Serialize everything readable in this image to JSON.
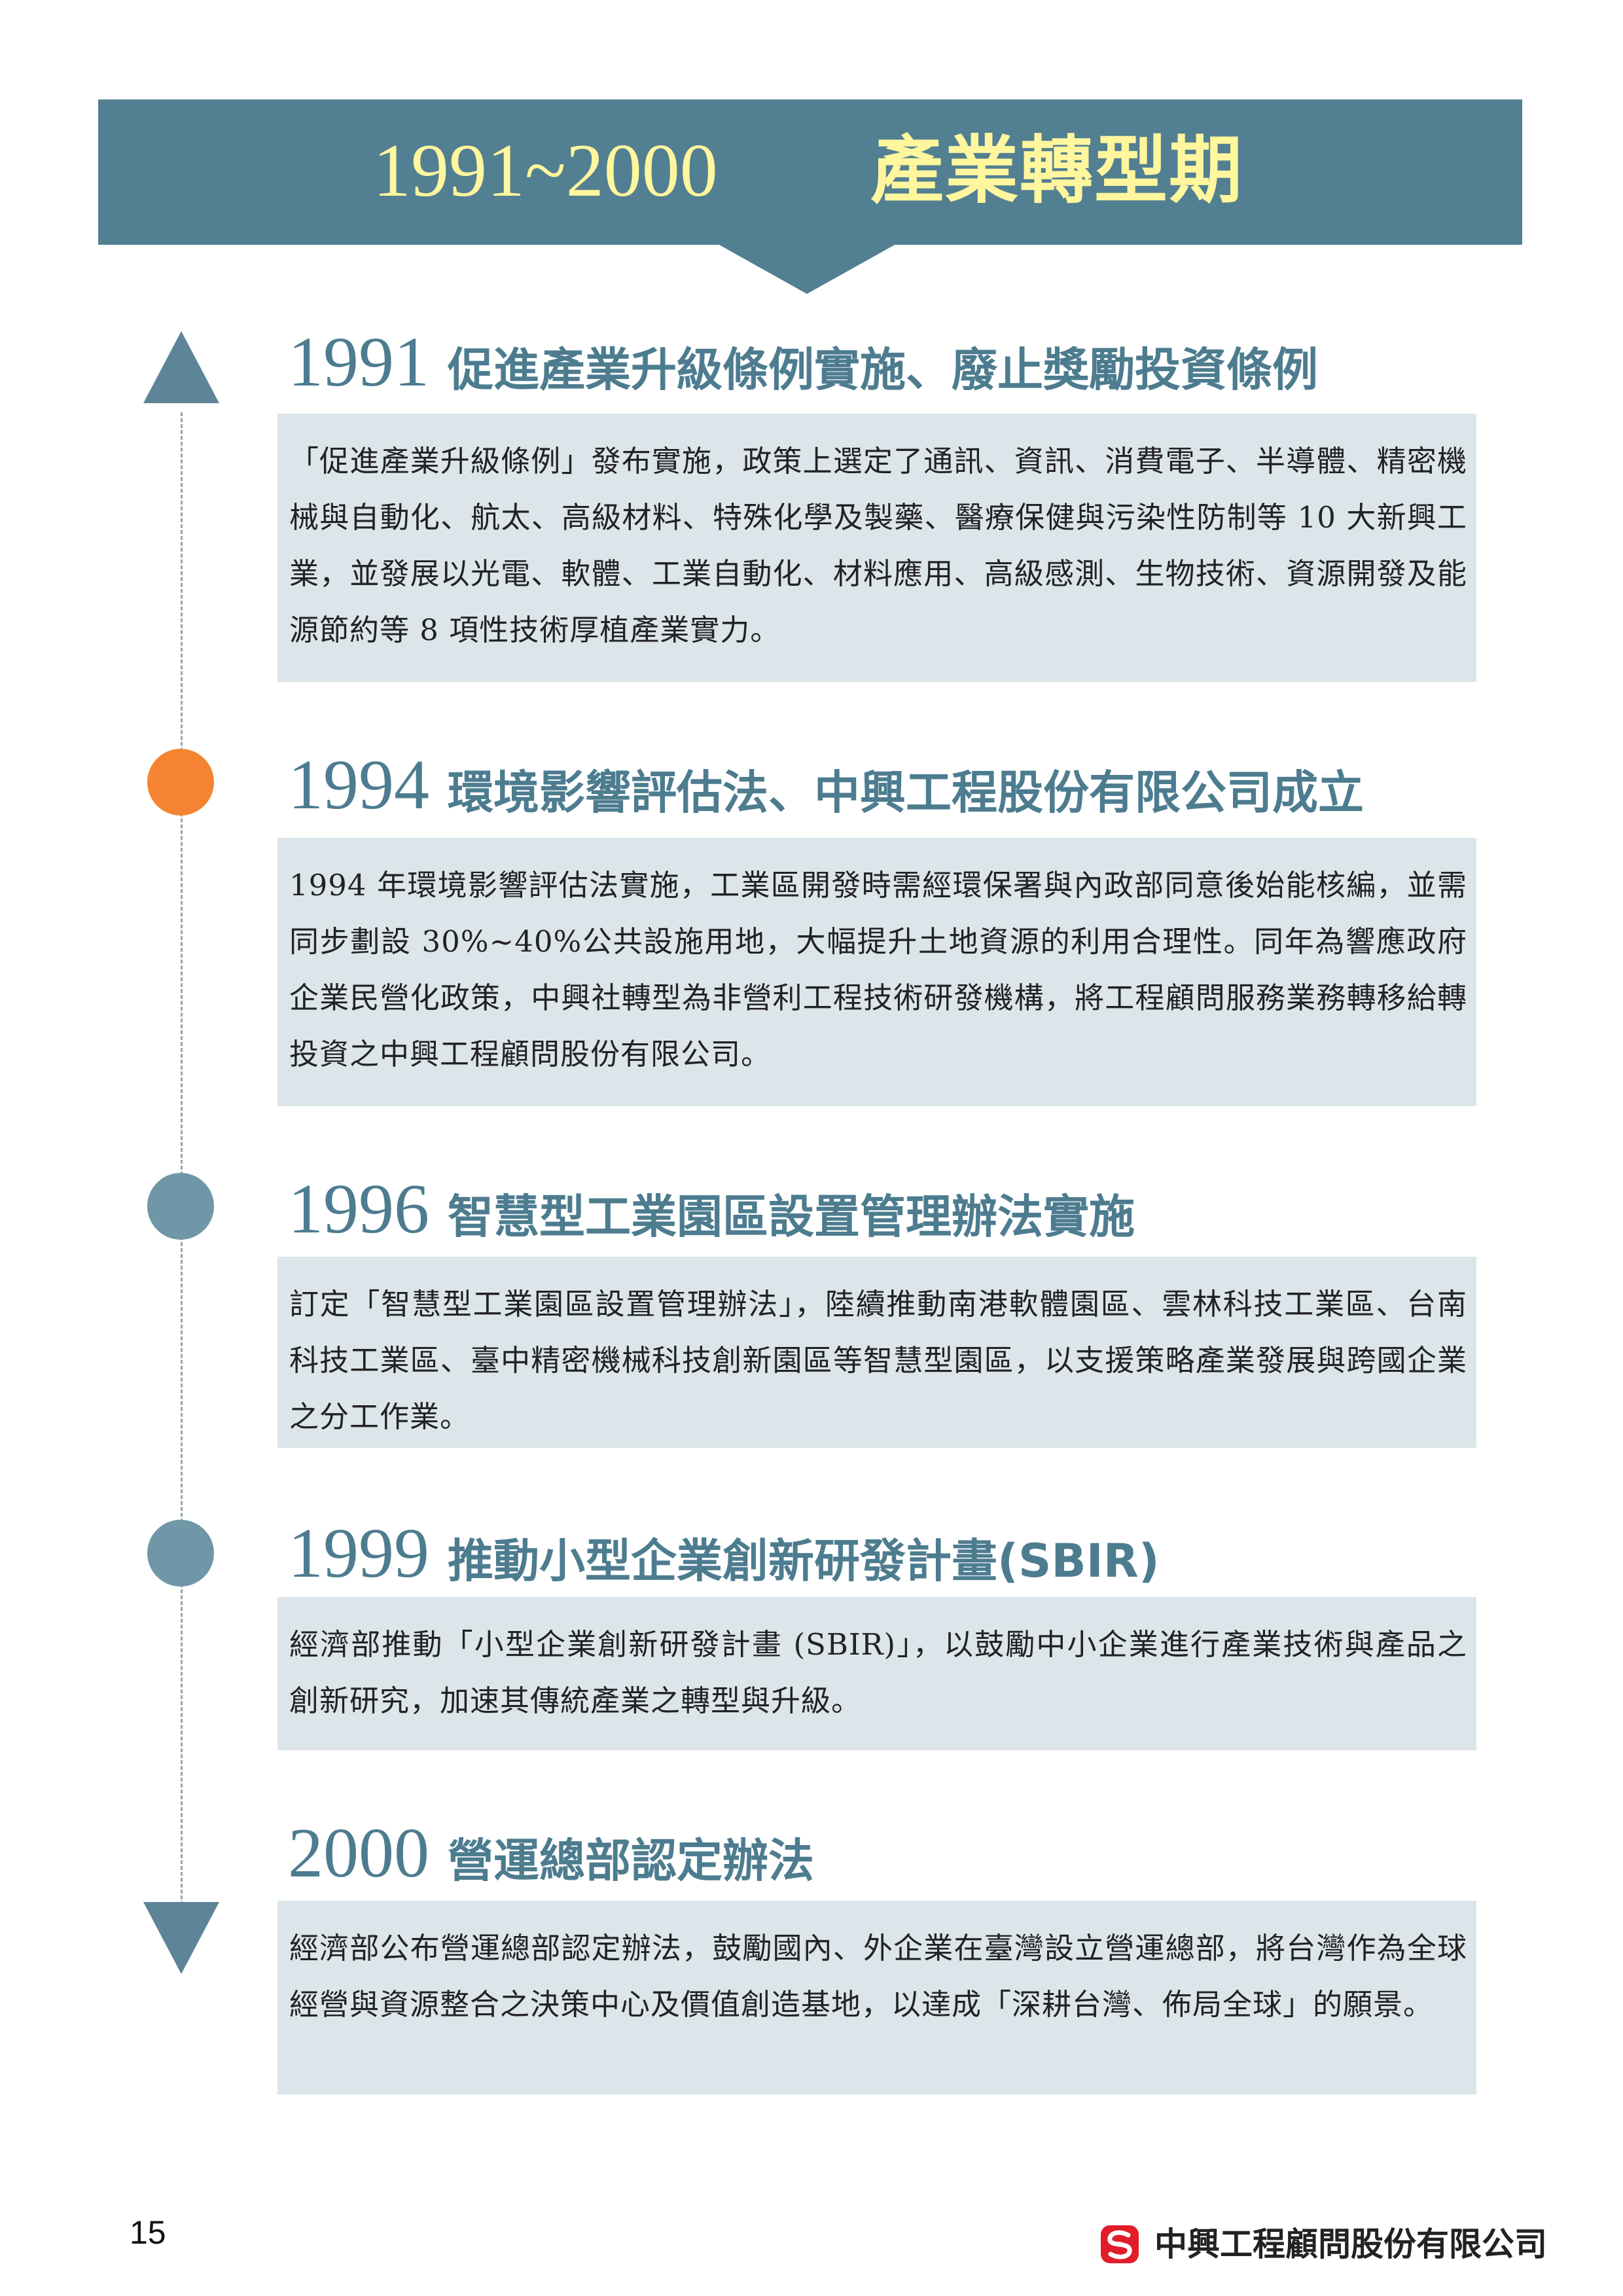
{
  "colors": {
    "banner": "#527f91",
    "banner_text": "#fff69e",
    "heading": "#4d7c8f",
    "box_background": "#dce5e9",
    "marker_blue": "#6f97a7",
    "marker_orange": "#f48431",
    "logo_red": "#e11d2a"
  },
  "banner": {
    "years": "1991~2000",
    "title": "產業轉型期"
  },
  "events": [
    {
      "year": "1991",
      "title": "促進產業升級條例實施、廢止獎勵投資條例",
      "marker": "triangle-up",
      "text": "「促進產業升級條例」發布實施，政策上選定了通訊、資訊、消費電子、半導體、精密機械與自動化、航太、高級材料、特殊化學及製藥、醫療保健與污染性防制等 10 大新興工業，並發展以光電、軟體、工業自動化、材料應用、高級感測、生物技術、資源開發及能源節約等 8 項性技術厚植產業實力。"
    },
    {
      "year": "1994",
      "title": "環境影響評估法、中興工程股份有限公司成立",
      "marker": "circle-orange",
      "text": "1994 年環境影響評估法實施，工業區開發時需經環保署與內政部同意後始能核編，並需同步劃設 30%~40%公共設施用地，大幅提升土地資源的利用合理性。同年為響應政府企業民營化政策，中興社轉型為非營利工程技術研發機構，將工程顧問服務業務轉移給轉投資之中興工程顧問股份有限公司。"
    },
    {
      "year": "1996",
      "title": "智慧型工業園區設置管理辦法實施",
      "marker": "circle-blue",
      "text": "訂定「智慧型工業園區設置管理辦法」，陸續推動南港軟體園區、雲林科技工業區、台南科技工業區、臺中精密機械科技創新園區等智慧型園區，以支援策略產業發展與跨國企業之分工作業。"
    },
    {
      "year": "1999",
      "title": "推動小型企業創新研發計畫(SBIR)",
      "marker": "circle-blue",
      "text": "經濟部推動「小型企業創新研發計畫 (SBIR)」，以鼓勵中小企業進行產業技術與產品之創新研究，加速其傳統產業之轉型與升級。"
    },
    {
      "year": "2000",
      "title": "營運總部認定辦法",
      "marker": "triangle-down",
      "text": "經濟部公布營運總部認定辦法，鼓勵國內、外企業在臺灣設立營運總部，將台灣作為全球經營與資源整合之決策中心及價值創造基地，以達成「深耕台灣、佈局全球」的願景。"
    }
  ],
  "footer": {
    "page_number": "15",
    "company": "中興工程顧問股份有限公司",
    "logo_icon": "sinotech-logo-icon"
  }
}
